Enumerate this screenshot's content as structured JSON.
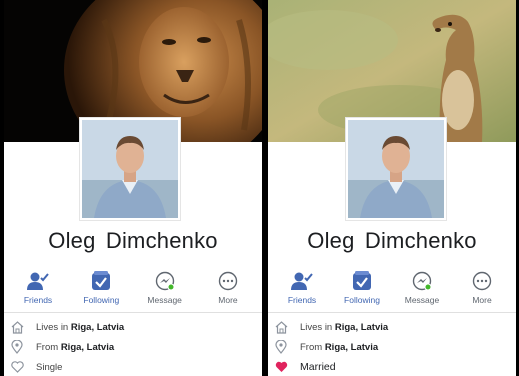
{
  "left": {
    "name": "Oleg  Dimchenko",
    "cover_icon": "lion-photo",
    "actions": [
      {
        "label": "Friends",
        "icon": "friends-icon"
      },
      {
        "label": "Following",
        "icon": "following-icon"
      },
      {
        "label": "Message",
        "icon": "messenger-icon"
      },
      {
        "label": "More",
        "icon": "more-icon"
      }
    ],
    "info": {
      "lives_prefix": "Lives in ",
      "lives_place": "Riga, Latvia",
      "from_prefix": "From ",
      "from_place": "Riga, Latvia",
      "status": "Single"
    }
  },
  "right": {
    "name": "Oleg  Dimchenko",
    "cover_icon": "gopher-photo",
    "actions": [
      {
        "label": "Friends",
        "icon": "friends-icon"
      },
      {
        "label": "Following",
        "icon": "following-icon"
      },
      {
        "label": "Message",
        "icon": "messenger-icon"
      },
      {
        "label": "More",
        "icon": "more-icon"
      }
    ],
    "info": {
      "lives_prefix": "Lives in ",
      "lives_place": "Riga, Latvia",
      "from_prefix": "From ",
      "from_place": "Riga, Latvia",
      "status": "Married"
    }
  },
  "colors": {
    "accent": "#4267b2",
    "heart": "#e0245e",
    "online": "#42b72a"
  }
}
